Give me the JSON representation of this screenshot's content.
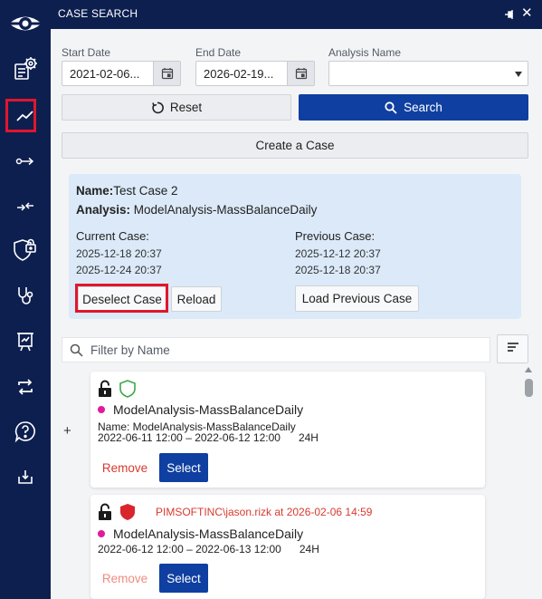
{
  "header": {
    "title": "CASE SEARCH"
  },
  "sidebar": {
    "items": [
      {
        "icon": "logo-eye-icon"
      },
      {
        "icon": "data-settings-icon"
      },
      {
        "icon": "trend-chart-icon",
        "active": true
      },
      {
        "icon": "arrow-connector-icon"
      },
      {
        "icon": "merge-arrows-icon"
      },
      {
        "icon": "shield-lock-icon"
      },
      {
        "icon": "stethoscope-icon"
      },
      {
        "icon": "presentation-board-icon"
      },
      {
        "icon": "swap-arrows-icon"
      },
      {
        "icon": "help-bubble-icon"
      },
      {
        "icon": "download-tray-icon"
      }
    ]
  },
  "form": {
    "start_label": "Start Date",
    "start_value": "2021-02-06...",
    "end_label": "End Date",
    "end_value": "2026-02-19...",
    "analysis_label": "Analysis Name",
    "analysis_value": "",
    "reset_label": "Reset",
    "search_label": "Search",
    "create_label": "Create a Case"
  },
  "case": {
    "name_label": "Name:",
    "name_value": "Test Case 2",
    "analysis_label": "Analysis:",
    "analysis_value": "ModelAnalysis-MassBalanceDaily",
    "current_label": "Current Case:",
    "current_dates": [
      "2025-12-18 20:37",
      "2025-12-24 20:37"
    ],
    "previous_label": "Previous Case:",
    "previous_dates": [
      "2025-12-12 20:37",
      "2025-12-18 20:37"
    ],
    "deselect_label": "Deselect Case",
    "reload_label": "Reload",
    "load_previous_label": "Load Previous Case"
  },
  "filter": {
    "placeholder": "Filter by Name"
  },
  "plus": "+",
  "cards": [
    {
      "title": "ModelAnalysis-MassBalanceDaily",
      "name_line": "Name: ModelAnalysis-MassBalanceDaily",
      "range": "2022-06-11 12:00 – 2022-06-12 12:00",
      "duration": "24H",
      "remove_label": "Remove",
      "select_label": "Select",
      "shield_color": "#3aa845",
      "user_stamp": ""
    },
    {
      "title": "ModelAnalysis-MassBalanceDaily",
      "name_line": "",
      "range": "2022-06-12 12:00 – 2022-06-13 12:00",
      "duration": "24H",
      "remove_label": "Remove",
      "select_label": "Select",
      "shield_color": "#d9262c",
      "user_stamp": "PIMSOFTINC\\jason.rizk at 2026-02-06 14:59"
    }
  ],
  "colors": {
    "sidebar": "#0d1f4f",
    "primary": "#0f3fa0",
    "highlight": "#e0162b",
    "panel": "#dbe9f8",
    "dot": "#e3199a"
  }
}
